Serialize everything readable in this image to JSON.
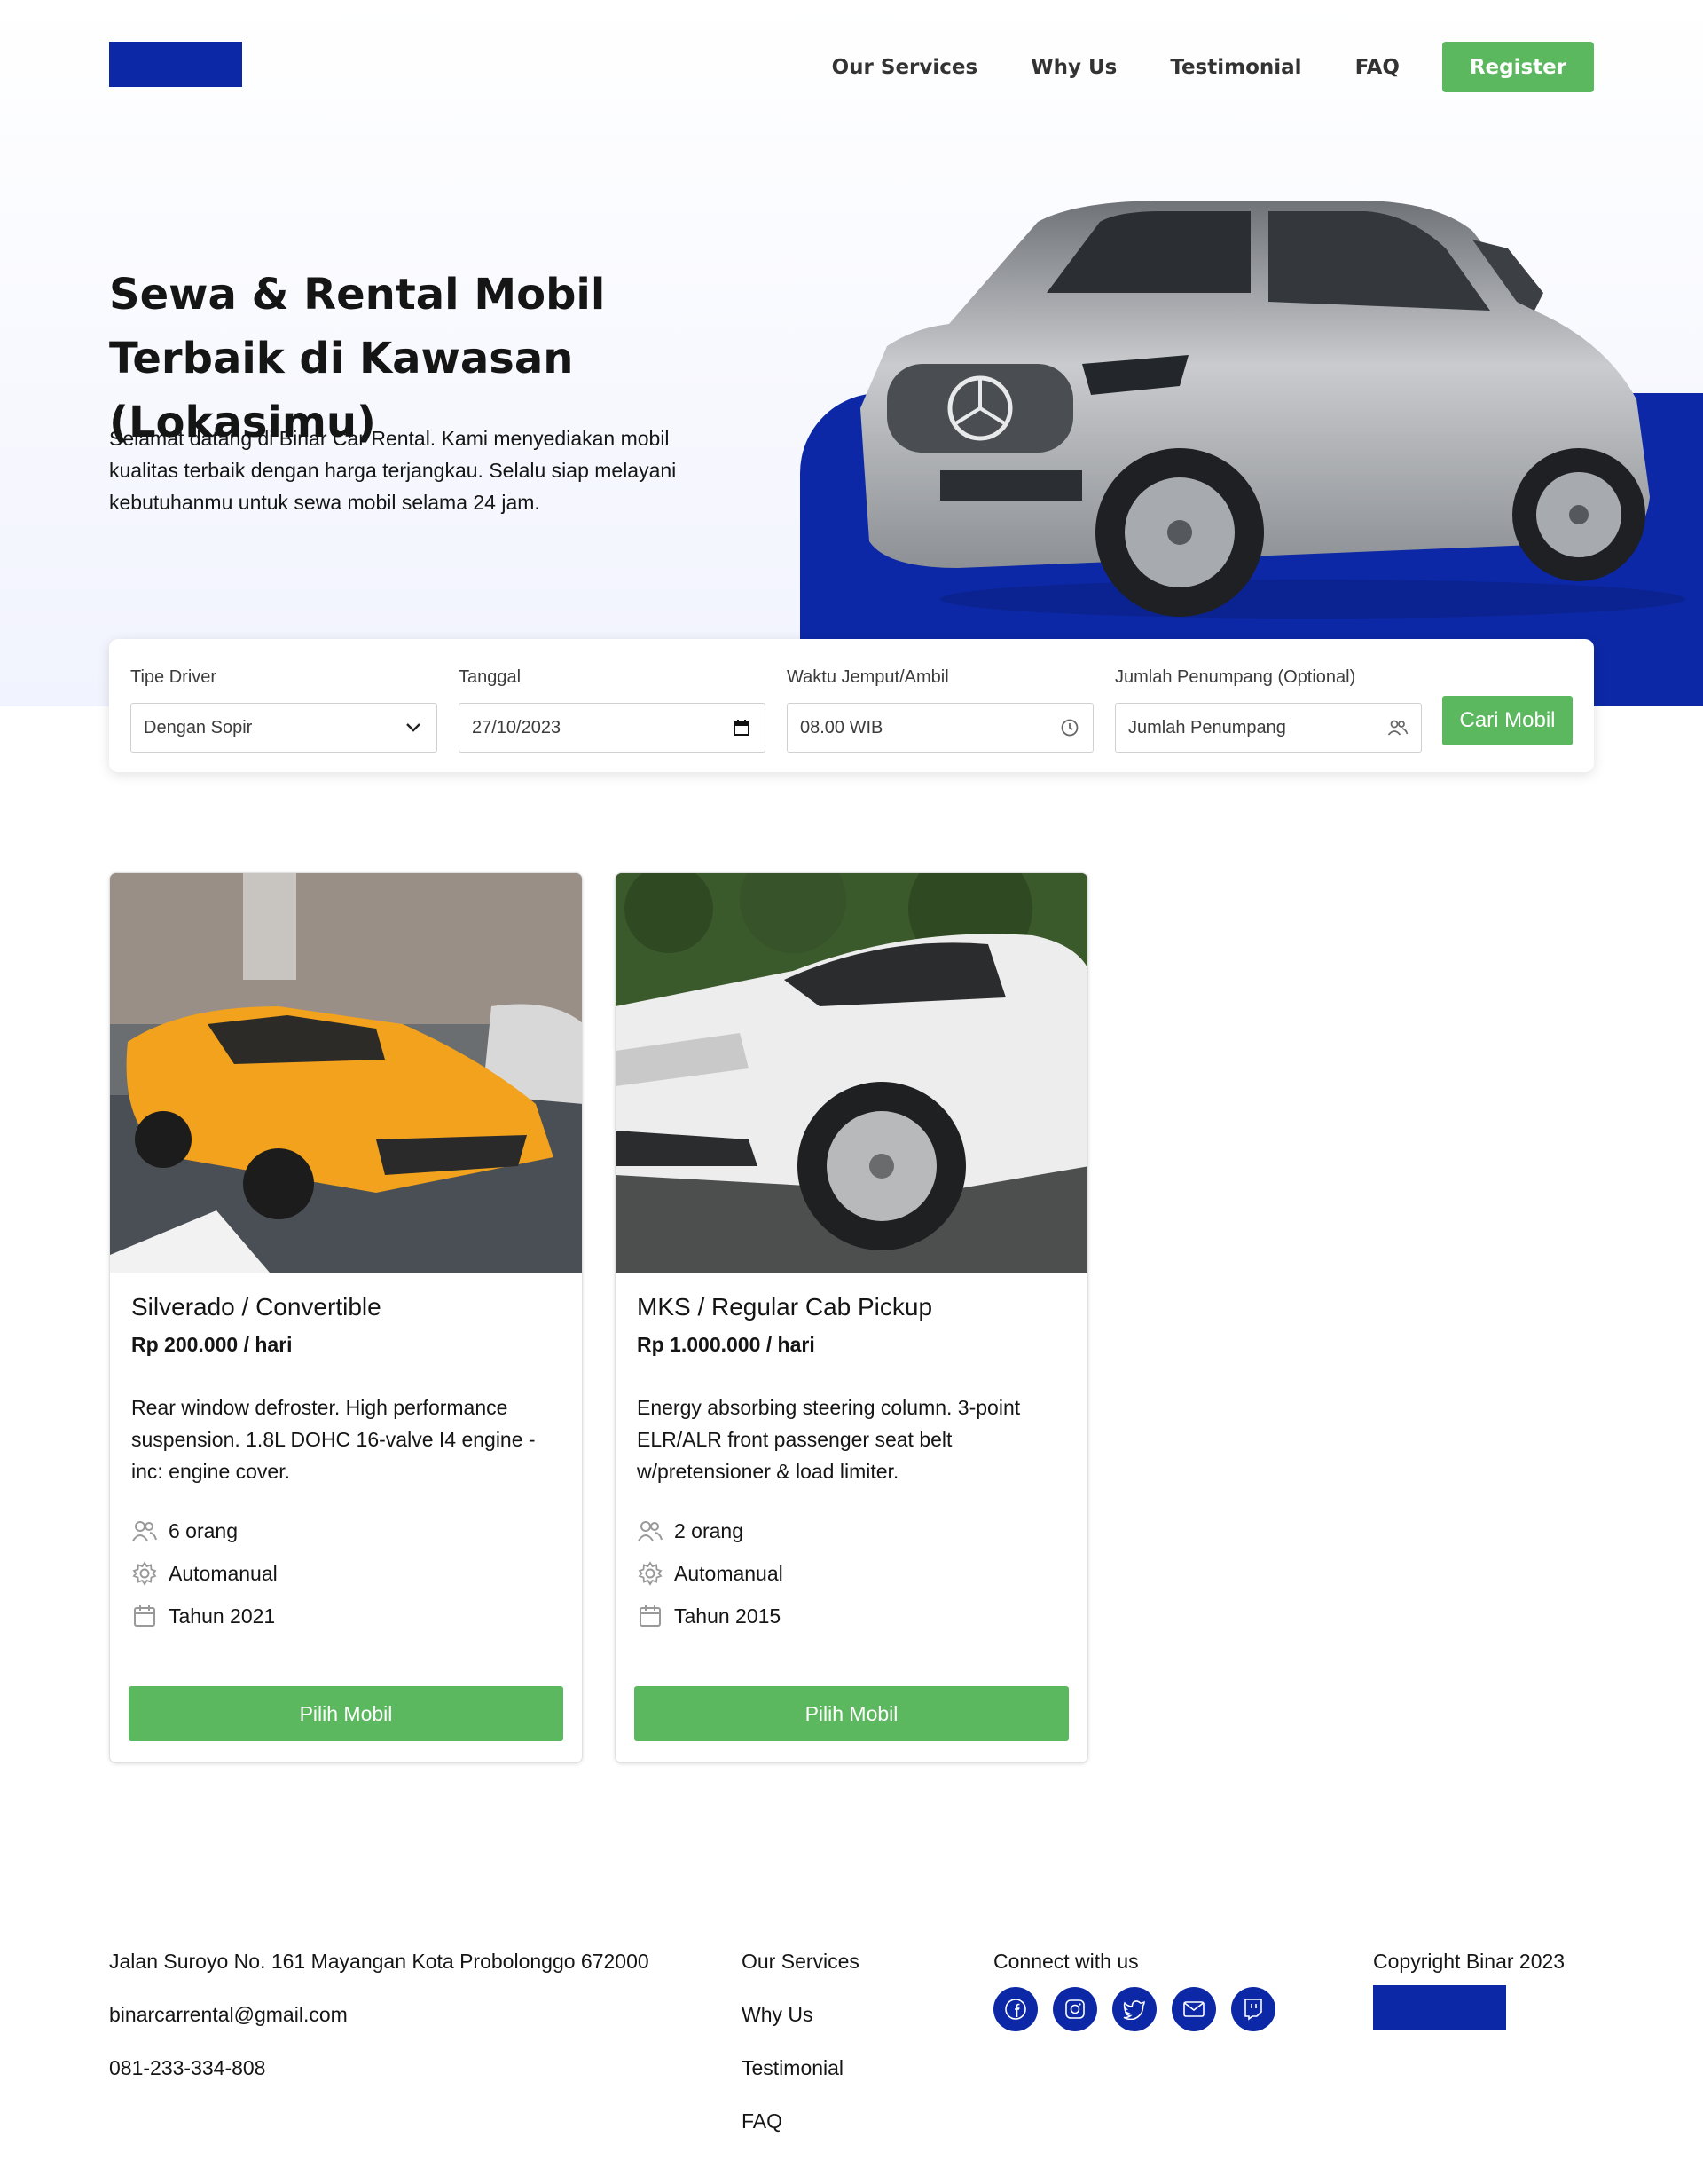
{
  "colors": {
    "brand_blue": "#0d28a6",
    "action_green": "#5cb85f",
    "hero_bg": "#f1f3fe"
  },
  "nav": {
    "links": [
      "Our Services",
      "Why Us",
      "Testimonial",
      "FAQ"
    ],
    "register_label": "Register"
  },
  "hero": {
    "title": "Sewa & Rental Mobil Terbaik di Kawasan (Lokasimu)",
    "description": "Selamat datang di Binar Car Rental. Kami menyediakan mobil kualitas terbaik dengan harga terjangkau. Selalu siap melayani kebutuhanmu untuk sewa mobil selama 24 jam."
  },
  "search": {
    "driver_label": "Tipe Driver",
    "driver_value": "Dengan Sopir",
    "date_label": "Tanggal",
    "date_value": "27/10/2023",
    "time_label": "Waktu Jemput/Ambil",
    "time_value": "08.00 WIB",
    "passenger_label": "Jumlah Penumpang (Optional)",
    "passenger_placeholder": "Jumlah Penumpang",
    "submit_label": "Cari Mobil"
  },
  "cars": [
    {
      "name": "Silverado / Convertible",
      "price": "Rp 200.000 / hari",
      "description": "Rear window defroster. High performance suspension. 1.8L DOHC 16-valve I4 engine - inc: engine cover.",
      "capacity": "6 orang",
      "transmission": "Automanual",
      "year": "Tahun 2021",
      "button": "Pilih Mobil",
      "image_icon": "orange-sports-car-photo"
    },
    {
      "name": "MKS / Regular Cab Pickup",
      "price": "Rp 1.000.000 / hari",
      "description": "Energy absorbing steering column. 3-point ELR/ALR front passenger seat belt w/pretensioner & load limiter.",
      "capacity": "2 orang",
      "transmission": "Automanual",
      "year": "Tahun 2015",
      "button": "Pilih Mobil",
      "image_icon": "white-suv-photo"
    }
  ],
  "footer": {
    "address": "Jalan Suroyo No. 161 Mayangan Kota Probolonggo 672000",
    "email": "binarcarrental@gmail.com",
    "phone": "081-233-334-808",
    "links": [
      "Our Services",
      "Why Us",
      "Testimonial",
      "FAQ"
    ],
    "connect_label": "Connect with us",
    "social_icons": [
      "facebook-icon",
      "instagram-icon",
      "twitter-icon",
      "mail-icon",
      "twitch-icon"
    ],
    "copyright": "Copyright Binar 2023"
  }
}
